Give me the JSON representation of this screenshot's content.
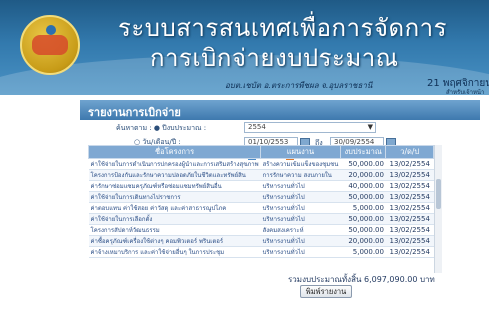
{
  "header": {
    "title_line1": "ระบบสารสนเทศเพื่อการจัดการ",
    "title_line2": "การเบิกจ่ายงบประมาณ",
    "user": "อบต.เชบัต อ.ตระการพืชผล จ.อุบลราชธานี",
    "date": "21 พฤศจิกายน 25",
    "sub": "สำหรับเจ้าหน้า"
  },
  "report": {
    "title": "รายงานการเบิกจ่าย",
    "filter": {
      "year_label": "ค้นหาตาม : ● ปีงบประมาณ :",
      "year_value": "2554",
      "date_label": "○ วัน/เดือน/ปี :",
      "date_from": "01/10/2553",
      "to_label": "ถึง",
      "date_to": "30/09/2554"
    },
    "ok_label": "ตกลง",
    "clear_label": "ยกเลิก",
    "columns": [
      "ชื่อโครงการ",
      "แผนงาน",
      "งบประมาณ",
      "ว/ด/ป"
    ],
    "rows": [
      {
        "name": "ค่าใช้จ่ายในการดำเนินการปกครองผู้นำและการเสริมสร้างสุขภาพ",
        "plan": "สร้างความเข้มแข็งของชุมชน",
        "amount": "50,000.00",
        "date": "13/02/2554"
      },
      {
        "name": "โครงการป้องกันและรักษาความปลอดภัยในชีวิตและทรัพย์สิน",
        "plan": "การรักษาความ สงบภายใน",
        "amount": "20,000.00",
        "date": "13/02/2554"
      },
      {
        "name": "ค่ารักษาซ่อมแซมครุภัณฑ์หรือซ่อมแซมทรัพย์สินอื่น",
        "plan": "บริหารงานทั่วไป",
        "amount": "40,000.00",
        "date": "13/02/2554"
      },
      {
        "name": "ค่าใช้จ่ายในการเดินทางไปราชการ",
        "plan": "บริหารงานทั่วไป",
        "amount": "50,000.00",
        "date": "13/02/2554"
      },
      {
        "name": "ค่าตอบแทน ค่าใช้สอย ค่าวัสดุ และค่าสาธารณูปโภค",
        "plan": "บริหารงานทั่วไป",
        "amount": "5,000.00",
        "date": "13/02/2554"
      },
      {
        "name": "ค่าใช้จ่ายในการเลือกตั้ง",
        "plan": "บริหารงานทั่วไป",
        "amount": "50,000.00",
        "date": "13/02/2554"
      },
      {
        "name": "โครงการสัปดาห์วัฒนธรรม",
        "plan": "สังคมสงเคราะห์",
        "amount": "50,000.00",
        "date": "13/02/2554"
      },
      {
        "name": "ค่าซื้อครุภัณฑ์เครื่องใช้ต่างๆ คอมพิวเตอร์ พรินเตอร์",
        "plan": "บริหารงานทั่วไป",
        "amount": "20,000.00",
        "date": "13/02/2554"
      },
      {
        "name": "ค่าจ้างเหมาบริการ และค่าใช้จ่ายอื่นๆ ในการประชุม",
        "plan": "บริหารงานทั่วไป",
        "amount": "5,000.00",
        "date": "13/02/2554"
      }
    ],
    "total_text": "รวมงบประมาณทั้งสิ้น 6,097,090.00 บาท",
    "print_label": "พิมพ์รายงาน"
  },
  "colors": {
    "header_top": "#1f5a86",
    "panel_head": "#3e79ae",
    "table_head": "#7fa8d2"
  },
  "icons": [
    "emblem-logo",
    "calendar-icon",
    "check-icon",
    "cancel-icon"
  ]
}
